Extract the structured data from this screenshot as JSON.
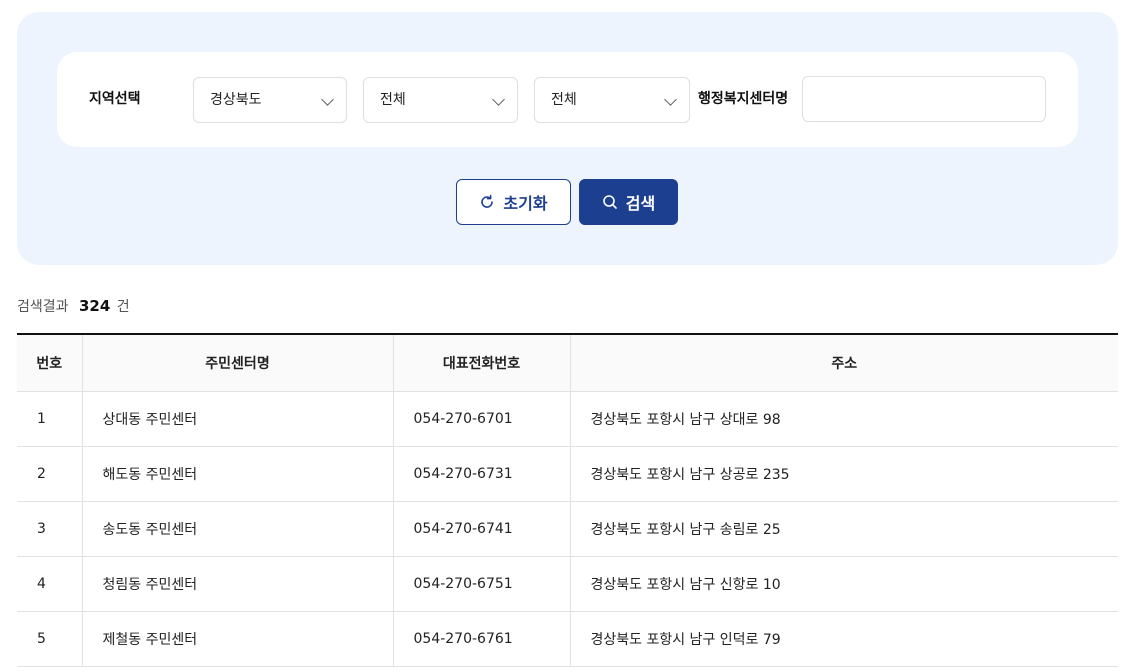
{
  "filter": {
    "region_label": "지역선택",
    "province": "경상북도",
    "city": "전체",
    "district": "전체",
    "center_name_label": "행정복지센터명",
    "center_name_value": "",
    "center_name_placeholder": ""
  },
  "buttons": {
    "reset_label": "초기화",
    "search_label": "검색"
  },
  "result": {
    "label": "검색결과",
    "count": "324",
    "unit": "건"
  },
  "table": {
    "headers": [
      "번호",
      "주민센터명",
      "대표전화번호",
      "주소"
    ],
    "rows": [
      {
        "no": "1",
        "name": "상대동 주민센터",
        "phone": "054-270-6701",
        "address": "경상북도 포항시 남구 상대로 98"
      },
      {
        "no": "2",
        "name": "해도동 주민센터",
        "phone": "054-270-6731",
        "address": "경상북도 포항시 남구 상공로 235"
      },
      {
        "no": "3",
        "name": "송도동 주민센터",
        "phone": "054-270-6741",
        "address": "경상북도 포항시 남구 송림로 25"
      },
      {
        "no": "4",
        "name": "청림동 주민센터",
        "phone": "054-270-6751",
        "address": "경상북도 포항시 남구 신항로 10"
      },
      {
        "no": "5",
        "name": "제철동 주민센터",
        "phone": "054-270-6761",
        "address": "경상북도 포항시 남구 인덕로 79"
      }
    ]
  },
  "colors": {
    "panel_bg": "#eef4fe",
    "primary": "#1c3f8f"
  }
}
